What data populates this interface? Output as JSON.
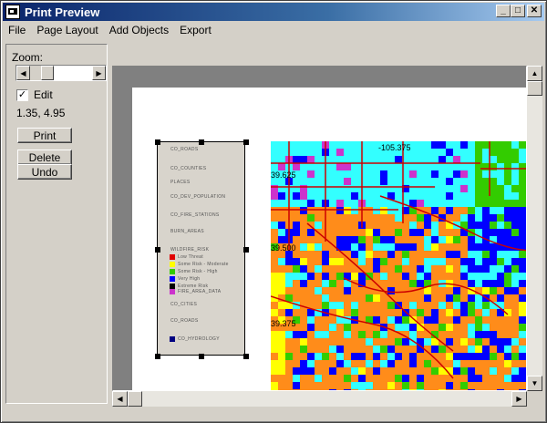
{
  "window": {
    "title": "Print Preview",
    "minimize_glyph": "_",
    "maximize_glyph": "□",
    "close_glyph": "✕"
  },
  "menu": {
    "items": [
      "File",
      "Page Layout",
      "Add Objects",
      "Export"
    ]
  },
  "panel": {
    "zoom_label": "Zoom:",
    "zoom_level": 0.2,
    "edit_label": "Edit",
    "edit_checked": true,
    "check_glyph": "✓",
    "coords": "1.35, 4.95",
    "print_label": "Print",
    "delete_label": "Delete",
    "undo_label": "Undo"
  },
  "legend": {
    "items": [
      "CO_ROADS",
      "CO_COUNTIES",
      "PLACES",
      "CO_DEV_POPULATION",
      "CO_FIRE_STATIONS",
      "BURN_AREAS",
      "WILDFIRE_RISK",
      "Low Threat",
      "Some Risk - Moderate",
      "Some Risk - High",
      "Very High",
      "Extreme Risk",
      "FIRE_AREA_DATA",
      "CO_CITIES",
      "CO_ROADS",
      "CO_HYDROLOGY"
    ]
  },
  "map": {
    "labels": [
      "39.625",
      "-105.375",
      "39.500",
      "39.375"
    ],
    "colors": {
      "orange": "#ff8c1a",
      "cyan": "#33ffff",
      "blue": "#0000ff",
      "green": "#33cc00",
      "yellow": "#ffff00",
      "red": "#e00000",
      "magenta": "#cc33cc",
      "road": "#cc0000"
    }
  }
}
